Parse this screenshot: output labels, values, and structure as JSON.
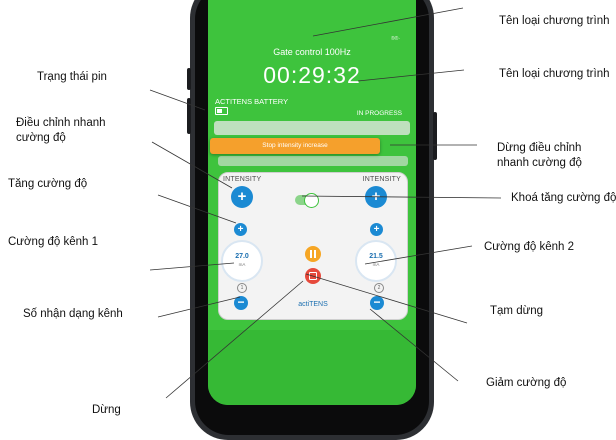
{
  "screen": {
    "program_name": "Gate control 100Hz",
    "timer": "00:29:32",
    "battery_label": "ACTITENS BATTERY",
    "status": "IN PROGRESS",
    "signal": "®®·",
    "notice_text": "Stop intensity increase",
    "intensity_left": "INTENSITY",
    "intensity_right": "INTENSITY",
    "channel1_value": "27.0",
    "channel1_unit": "mA",
    "channel2_value": "21.5",
    "channel2_unit": "mA",
    "brand": "actiTENS",
    "channel1_id": "1",
    "channel2_id": "2"
  },
  "callouts": {
    "right": [
      "Tên loại chương trình",
      "Tên loại chương trình",
      "Dừng điều chỉnh",
      "nhanh cường độ",
      "Khoá tăng cường độ",
      "Cường độ kênh 2",
      "Tạm dừng",
      "Giảm cường độ"
    ],
    "left": [
      "Trạng thái pin",
      "Điều chỉnh nhanh",
      "cường độ",
      "Tăng cường độ",
      "Cường độ kênh 1",
      "Số nhận dạng kênh",
      "Dừng"
    ]
  },
  "colors": {
    "screen_green": "#3ec33d",
    "accent_blue": "#1b8ad3",
    "pause_orange": "#f6a624",
    "stop_red": "#e64a3c",
    "notice_orange": "#f5a02c"
  }
}
